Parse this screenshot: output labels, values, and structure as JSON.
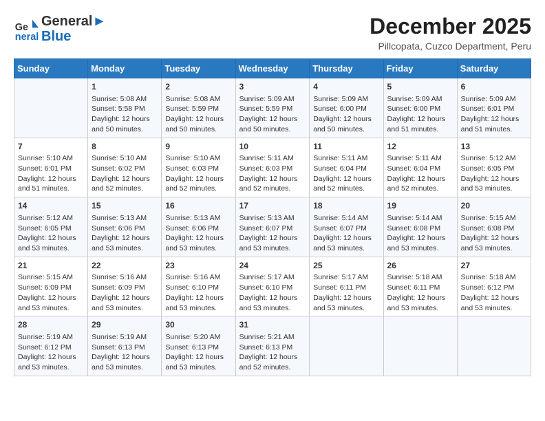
{
  "header": {
    "logo_line1": "General",
    "logo_line2": "Blue",
    "month_title": "December 2025",
    "subtitle": "Pillcopata, Cuzco Department, Peru"
  },
  "weekdays": [
    "Sunday",
    "Monday",
    "Tuesday",
    "Wednesday",
    "Thursday",
    "Friday",
    "Saturday"
  ],
  "weeks": [
    [
      {
        "day": "",
        "content": ""
      },
      {
        "day": "1",
        "content": "Sunrise: 5:08 AM\nSunset: 5:58 PM\nDaylight: 12 hours\nand 50 minutes."
      },
      {
        "day": "2",
        "content": "Sunrise: 5:08 AM\nSunset: 5:59 PM\nDaylight: 12 hours\nand 50 minutes."
      },
      {
        "day": "3",
        "content": "Sunrise: 5:09 AM\nSunset: 5:59 PM\nDaylight: 12 hours\nand 50 minutes."
      },
      {
        "day": "4",
        "content": "Sunrise: 5:09 AM\nSunset: 6:00 PM\nDaylight: 12 hours\nand 50 minutes."
      },
      {
        "day": "5",
        "content": "Sunrise: 5:09 AM\nSunset: 6:00 PM\nDaylight: 12 hours\nand 51 minutes."
      },
      {
        "day": "6",
        "content": "Sunrise: 5:09 AM\nSunset: 6:01 PM\nDaylight: 12 hours\nand 51 minutes."
      }
    ],
    [
      {
        "day": "7",
        "content": "Sunrise: 5:10 AM\nSunset: 6:01 PM\nDaylight: 12 hours\nand 51 minutes."
      },
      {
        "day": "8",
        "content": "Sunrise: 5:10 AM\nSunset: 6:02 PM\nDaylight: 12 hours\nand 52 minutes."
      },
      {
        "day": "9",
        "content": "Sunrise: 5:10 AM\nSunset: 6:03 PM\nDaylight: 12 hours\nand 52 minutes."
      },
      {
        "day": "10",
        "content": "Sunrise: 5:11 AM\nSunset: 6:03 PM\nDaylight: 12 hours\nand 52 minutes."
      },
      {
        "day": "11",
        "content": "Sunrise: 5:11 AM\nSunset: 6:04 PM\nDaylight: 12 hours\nand 52 minutes."
      },
      {
        "day": "12",
        "content": "Sunrise: 5:11 AM\nSunset: 6:04 PM\nDaylight: 12 hours\nand 52 minutes."
      },
      {
        "day": "13",
        "content": "Sunrise: 5:12 AM\nSunset: 6:05 PM\nDaylight: 12 hours\nand 53 minutes."
      }
    ],
    [
      {
        "day": "14",
        "content": "Sunrise: 5:12 AM\nSunset: 6:05 PM\nDaylight: 12 hours\nand 53 minutes."
      },
      {
        "day": "15",
        "content": "Sunrise: 5:13 AM\nSunset: 6:06 PM\nDaylight: 12 hours\nand 53 minutes."
      },
      {
        "day": "16",
        "content": "Sunrise: 5:13 AM\nSunset: 6:06 PM\nDaylight: 12 hours\nand 53 minutes."
      },
      {
        "day": "17",
        "content": "Sunrise: 5:13 AM\nSunset: 6:07 PM\nDaylight: 12 hours\nand 53 minutes."
      },
      {
        "day": "18",
        "content": "Sunrise: 5:14 AM\nSunset: 6:07 PM\nDaylight: 12 hours\nand 53 minutes."
      },
      {
        "day": "19",
        "content": "Sunrise: 5:14 AM\nSunset: 6:08 PM\nDaylight: 12 hours\nand 53 minutes."
      },
      {
        "day": "20",
        "content": "Sunrise: 5:15 AM\nSunset: 6:08 PM\nDaylight: 12 hours\nand 53 minutes."
      }
    ],
    [
      {
        "day": "21",
        "content": "Sunrise: 5:15 AM\nSunset: 6:09 PM\nDaylight: 12 hours\nand 53 minutes."
      },
      {
        "day": "22",
        "content": "Sunrise: 5:16 AM\nSunset: 6:09 PM\nDaylight: 12 hours\nand 53 minutes."
      },
      {
        "day": "23",
        "content": "Sunrise: 5:16 AM\nSunset: 6:10 PM\nDaylight: 12 hours\nand 53 minutes."
      },
      {
        "day": "24",
        "content": "Sunrise: 5:17 AM\nSunset: 6:10 PM\nDaylight: 12 hours\nand 53 minutes."
      },
      {
        "day": "25",
        "content": "Sunrise: 5:17 AM\nSunset: 6:11 PM\nDaylight: 12 hours\nand 53 minutes."
      },
      {
        "day": "26",
        "content": "Sunrise: 5:18 AM\nSunset: 6:11 PM\nDaylight: 12 hours\nand 53 minutes."
      },
      {
        "day": "27",
        "content": "Sunrise: 5:18 AM\nSunset: 6:12 PM\nDaylight: 12 hours\nand 53 minutes."
      }
    ],
    [
      {
        "day": "28",
        "content": "Sunrise: 5:19 AM\nSunset: 6:12 PM\nDaylight: 12 hours\nand 53 minutes."
      },
      {
        "day": "29",
        "content": "Sunrise: 5:19 AM\nSunset: 6:13 PM\nDaylight: 12 hours\nand 53 minutes."
      },
      {
        "day": "30",
        "content": "Sunrise: 5:20 AM\nSunset: 6:13 PM\nDaylight: 12 hours\nand 53 minutes."
      },
      {
        "day": "31",
        "content": "Sunrise: 5:21 AM\nSunset: 6:13 PM\nDaylight: 12 hours\nand 52 minutes."
      },
      {
        "day": "",
        "content": ""
      },
      {
        "day": "",
        "content": ""
      },
      {
        "day": "",
        "content": ""
      }
    ]
  ]
}
